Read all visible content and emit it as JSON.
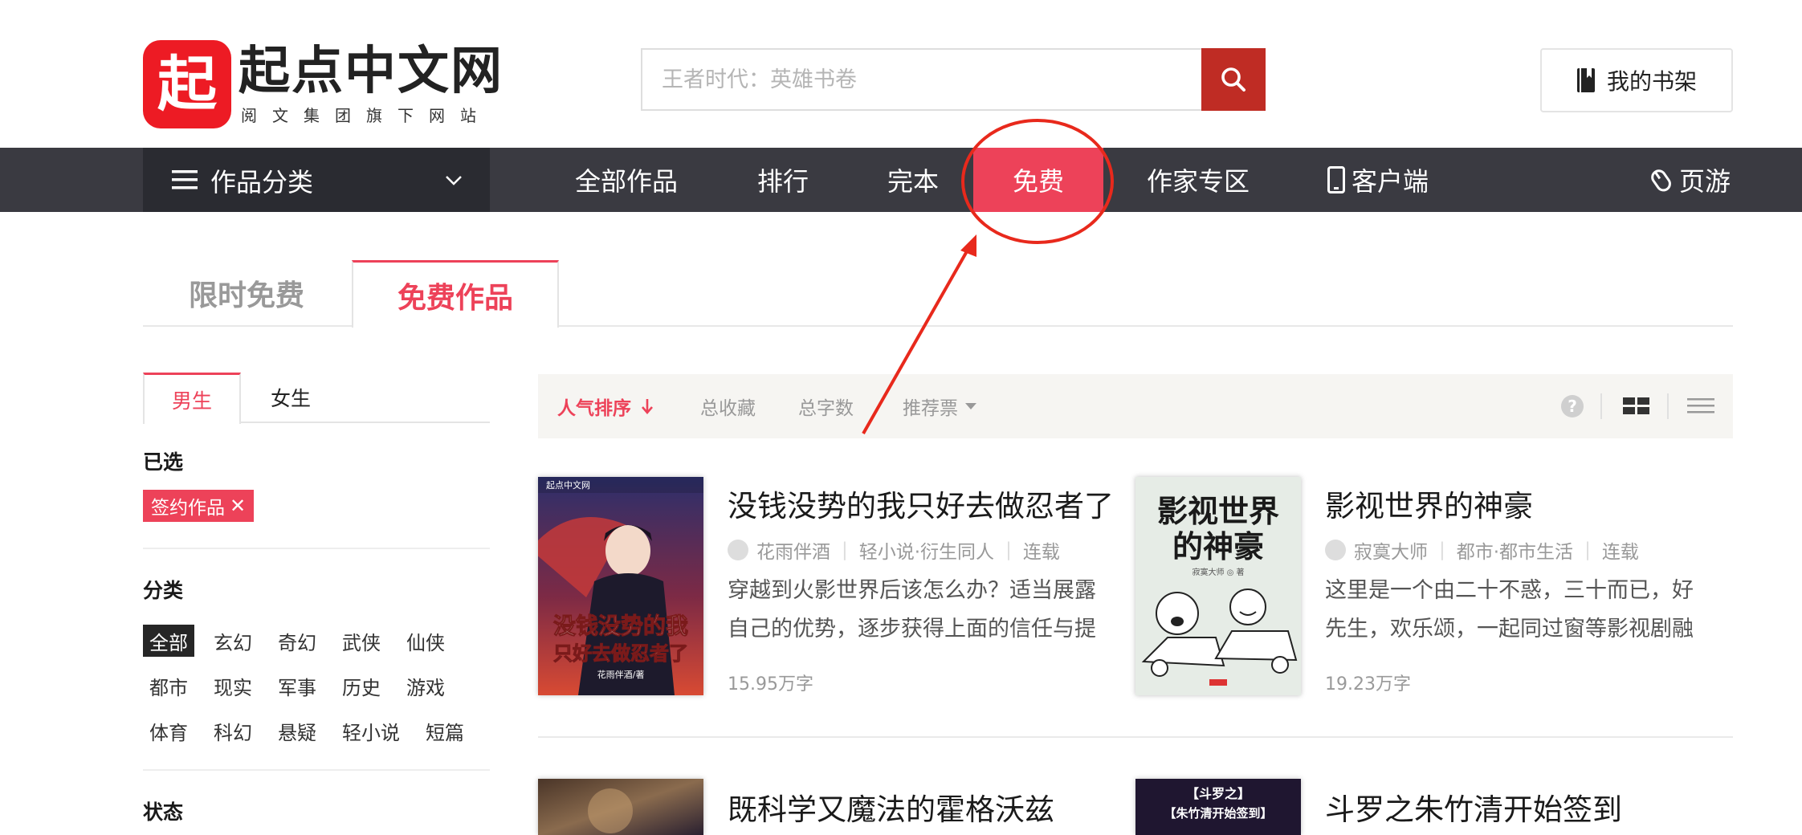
{
  "brand": {
    "logo_char": "起",
    "name": "起点中文网",
    "tagline": "阅文集团旗下网站"
  },
  "search": {
    "placeholder": "王者时代：英雄书卷"
  },
  "shelf": {
    "label": "我的书架"
  },
  "nav": {
    "category_menu": "作品分类",
    "items": [
      "全部作品",
      "排行",
      "完本",
      "免费",
      "作家专区",
      "客户端",
      "页游"
    ],
    "active": "免费"
  },
  "tabs": {
    "items": [
      "限时免费",
      "免费作品"
    ],
    "active": "免费作品"
  },
  "sidebar": {
    "gender_tabs": [
      "男生",
      "女生"
    ],
    "gender_active": "男生",
    "selected_heading": "已选",
    "selected_chips": [
      "签约作品"
    ],
    "category_heading": "分类",
    "categories": [
      "全部",
      "玄幻",
      "奇幻",
      "武侠",
      "仙侠",
      "都市",
      "现实",
      "军事",
      "历史",
      "游戏",
      "体育",
      "科幻",
      "悬疑",
      "轻小说",
      "短篇"
    ],
    "category_active": "全部",
    "status_heading": "状态"
  },
  "sort": {
    "items": [
      "人气排序",
      "总收藏",
      "总字数",
      "推荐票"
    ],
    "active": "人气排序"
  },
  "books": [
    {
      "title": "没钱没势的我只好去做忍者了",
      "author": "花雨伴酒",
      "category": "轻小说·衍生同人",
      "status": "连载",
      "intro": "穿越到火影世界后该怎么办？适当展露自己的优势，逐步获得上面的信任与提",
      "words": "15.95万字",
      "cover_text": [
        "没钱没势的我",
        "只好去做忍者了"
      ],
      "cover_author": "花雨伴酒/著",
      "cover_brand": "起点中文网"
    },
    {
      "title": "影视世界的神豪",
      "author": "寂寞大师",
      "category": "都市·都市生活",
      "status": "连载",
      "intro": "这里是一个由二十不惑，三十而已，好先生，欢乐颂，一起同过窗等影视剧融",
      "words": "19.23万字",
      "cover_text": [
        "影视世界",
        "的神豪"
      ],
      "cover_author": "寂寞大师 ◎ 著"
    },
    {
      "title": "既科学又魔法的霍格沃兹"
    },
    {
      "title": "斗罗之朱竹清开始签到",
      "cover_text": [
        "【斗罗之】",
        "【朱竹清开始签到】"
      ]
    }
  ],
  "colors": {
    "brand_red": "#ed1b24",
    "accent": "#ed4259",
    "nav_bg": "#3a3a41",
    "annotation_red": "#e8291c"
  }
}
